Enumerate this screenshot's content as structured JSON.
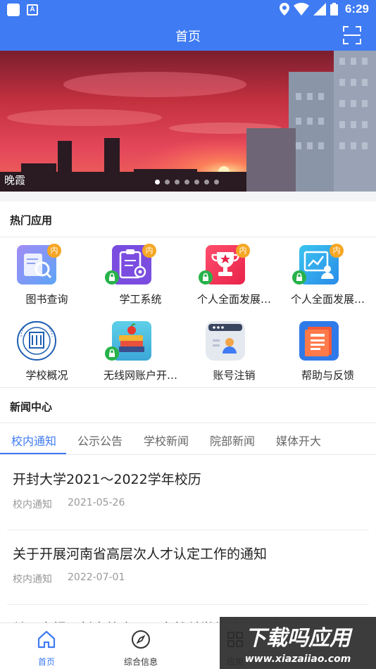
{
  "status_bar": {
    "time": "6:29",
    "left_icons": [
      "notification-square-icon",
      "a-square-icon"
    ],
    "right_icons": [
      "location-icon",
      "wifi-icon",
      "signal-icon",
      "battery-icon"
    ]
  },
  "header": {
    "title": "首页",
    "scan_icon": "scan-icon",
    "color": "#3f7bf2"
  },
  "banner": {
    "caption": "晚霞",
    "slide_count": 7,
    "active_index": 0
  },
  "hot_apps": {
    "title": "热门应用",
    "items": [
      {
        "label": "图书查询",
        "icon": "book-search-icon",
        "badge": "内",
        "locked": false
      },
      {
        "label": "学工系统",
        "icon": "clipboard-gear-icon",
        "badge": "内",
        "locked": true
      },
      {
        "label": "个人全面发展…",
        "icon": "trophy-icon",
        "badge": "内",
        "locked": true
      },
      {
        "label": "个人全面发展…",
        "icon": "growth-chart-person-icon",
        "badge": "内",
        "locked": true
      },
      {
        "label": "学校概况",
        "icon": "university-seal-icon",
        "badge": "",
        "locked": false
      },
      {
        "label": "无线网账户开…",
        "icon": "books-apple-icon",
        "badge": "",
        "locked": true
      },
      {
        "label": "账号注销",
        "icon": "account-card-icon",
        "badge": "",
        "locked": false
      },
      {
        "label": "帮助与反馈",
        "icon": "document-help-icon",
        "badge": "",
        "locked": false
      }
    ]
  },
  "news": {
    "title": "新闻中心",
    "tabs": [
      "校内通知",
      "公示公告",
      "学校新闻",
      "院部新闻",
      "媒体开大"
    ],
    "active_tab": 0,
    "items": [
      {
        "title": "开封大学2021～2022学年校历",
        "category": "校内通知",
        "date": "2021-05-26"
      },
      {
        "title": "关于开展河南省高层次人才认定工作的通知",
        "category": "校内通知",
        "date": "2022-07-01"
      },
      {
        "title": "关于申报开封市第十八届自然科学优秀学术成果奖的通",
        "category": "",
        "date": ""
      }
    ]
  },
  "bottom_nav": {
    "items": [
      {
        "label": "首页",
        "icon": "home-icon"
      },
      {
        "label": "综合信息",
        "icon": "compass-icon"
      },
      {
        "label": "应用",
        "icon": "apps-icon"
      }
    ],
    "active_index": 0
  },
  "watermark": {
    "line1": "下载吗应用",
    "line2": "www.xiazaiiao.com"
  },
  "colors": {
    "accent": "#3f7bf2",
    "badge": "#f5a623",
    "lock": "#27b24a"
  }
}
